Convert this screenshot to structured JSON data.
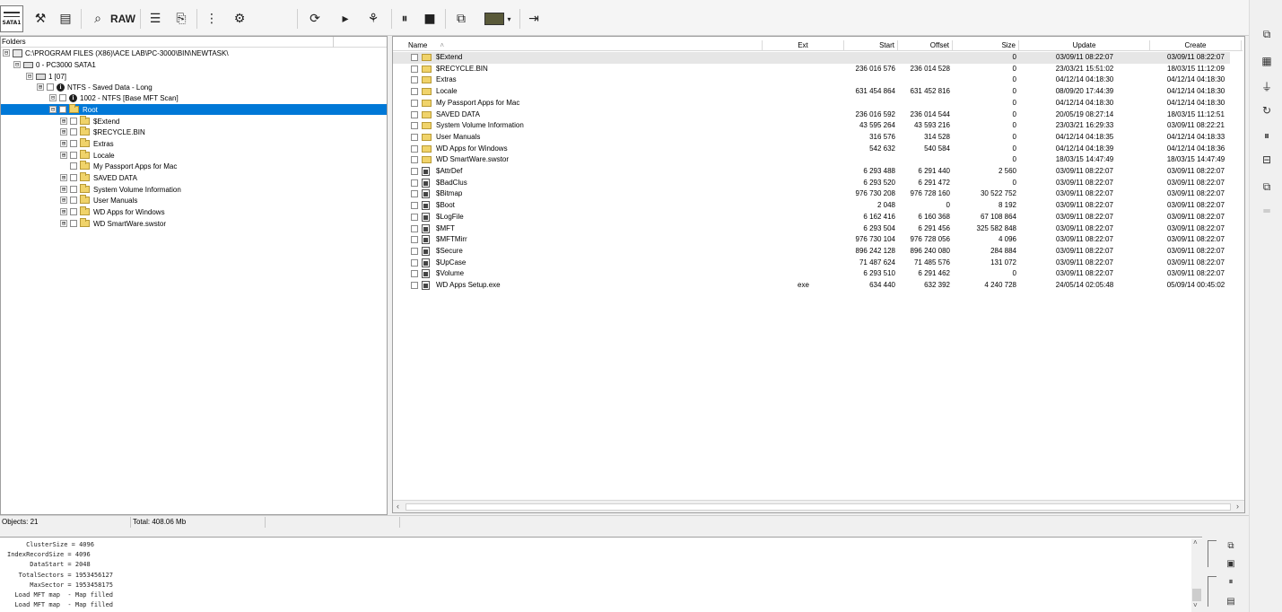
{
  "toolbar": {
    "device_label": "SATA1",
    "raw_label": "RAW"
  },
  "folders": {
    "header": "Folders",
    "tree": [
      {
        "label": "C:\\PROGRAM FILES (X86)\\ACE LAB\\PC-3000\\BIN\\NEWTASK\\",
        "exp": "⊟"
      },
      {
        "label": "0 - PC3000 SATA1",
        "exp": "⊟"
      },
      {
        "label": "1 [07]",
        "exp": "⊟"
      },
      {
        "label": "NTFS - Saved Data - Long",
        "exp": "⊞"
      },
      {
        "label": "1002 - NTFS [Base MFT Scan]",
        "exp": "⊟"
      },
      {
        "label": "Root",
        "exp": "⊟"
      },
      {
        "label": "$Extend",
        "exp": "⊞"
      },
      {
        "label": "$RECYCLE.BIN",
        "exp": "⊞"
      },
      {
        "label": "Extras",
        "exp": "⊞"
      },
      {
        "label": "Locale",
        "exp": "⊞"
      },
      {
        "label": "My Passport Apps for Mac",
        "exp": ""
      },
      {
        "label": "SAVED DATA",
        "exp": "⊞"
      },
      {
        "label": "System Volume Information",
        "exp": "⊞"
      },
      {
        "label": "User Manuals",
        "exp": "⊞"
      },
      {
        "label": "WD Apps for Windows",
        "exp": "⊞"
      },
      {
        "label": "WD SmartWare.swstor",
        "exp": "⊞"
      }
    ]
  },
  "files": {
    "columns": {
      "name": "Name",
      "ext": "Ext",
      "start": "Start",
      "offset": "Offset",
      "size": "Size",
      "update": "Update",
      "create": "Create"
    },
    "rows": [
      {
        "type": "dir",
        "name": "$Extend",
        "ext": "",
        "start": "",
        "offset": "",
        "size": "0",
        "update": "03/09/11 08:22:07",
        "create": "03/09/11 08:22:07"
      },
      {
        "type": "dir",
        "name": "$RECYCLE.BIN",
        "ext": "",
        "start": "236 016 576",
        "offset": "236 014 528",
        "size": "0",
        "update": "23/03/21 15:51:02",
        "create": "18/03/15 11:12:09"
      },
      {
        "type": "dir",
        "name": "Extras",
        "ext": "",
        "start": "",
        "offset": "",
        "size": "0",
        "update": "04/12/14 04:18:30",
        "create": "04/12/14 04:18:30"
      },
      {
        "type": "dir",
        "name": "Locale",
        "ext": "",
        "start": "631 454 864",
        "offset": "631 452 816",
        "size": "0",
        "update": "08/09/20 17:44:39",
        "create": "04/12/14 04:18:30"
      },
      {
        "type": "dir",
        "name": "My Passport Apps for Mac",
        "ext": "",
        "start": "",
        "offset": "",
        "size": "0",
        "update": "04/12/14 04:18:30",
        "create": "04/12/14 04:18:30"
      },
      {
        "type": "dir",
        "name": "SAVED DATA",
        "ext": "",
        "start": "236 016 592",
        "offset": "236 014 544",
        "size": "0",
        "update": "20/05/19 08:27:14",
        "create": "18/03/15 11:12:51"
      },
      {
        "type": "dir",
        "name": "System Volume Information",
        "ext": "",
        "start": "43 595 264",
        "offset": "43 593 216",
        "size": "0",
        "update": "23/03/21 16:29:33",
        "create": "03/09/11 08:22:21"
      },
      {
        "type": "dir",
        "name": "User Manuals",
        "ext": "",
        "start": "316 576",
        "offset": "314 528",
        "size": "0",
        "update": "04/12/14 04:18:35",
        "create": "04/12/14 04:18:33"
      },
      {
        "type": "dir",
        "name": "WD Apps for Windows",
        "ext": "",
        "start": "542 632",
        "offset": "540 584",
        "size": "0",
        "update": "04/12/14 04:18:39",
        "create": "04/12/14 04:18:36"
      },
      {
        "type": "dir",
        "name": "WD SmartWare.swstor",
        "ext": "",
        "start": "",
        "offset": "",
        "size": "0",
        "update": "18/03/15 14:47:49",
        "create": "18/03/15 14:47:49"
      },
      {
        "type": "file",
        "name": "$AttrDef",
        "ext": "",
        "start": "6 293 488",
        "offset": "6 291 440",
        "size": "2 560",
        "update": "03/09/11 08:22:07",
        "create": "03/09/11 08:22:07"
      },
      {
        "type": "file",
        "name": "$BadClus",
        "ext": "",
        "start": "6 293 520",
        "offset": "6 291 472",
        "size": "0",
        "update": "03/09/11 08:22:07",
        "create": "03/09/11 08:22:07"
      },
      {
        "type": "file",
        "name": "$Bitmap",
        "ext": "",
        "start": "976 730 208",
        "offset": "976 728 160",
        "size": "30 522 752",
        "update": "03/09/11 08:22:07",
        "create": "03/09/11 08:22:07"
      },
      {
        "type": "file",
        "name": "$Boot",
        "ext": "",
        "start": "2 048",
        "offset": "0",
        "size": "8 192",
        "update": "03/09/11 08:22:07",
        "create": "03/09/11 08:22:07"
      },
      {
        "type": "file",
        "name": "$LogFile",
        "ext": "",
        "start": "6 162 416",
        "offset": "6 160 368",
        "size": "67 108 864",
        "update": "03/09/11 08:22:07",
        "create": "03/09/11 08:22:07"
      },
      {
        "type": "file",
        "name": "$MFT",
        "ext": "",
        "start": "6 293 504",
        "offset": "6 291 456",
        "size": "325 582 848",
        "update": "03/09/11 08:22:07",
        "create": "03/09/11 08:22:07"
      },
      {
        "type": "file",
        "name": "$MFTMirr",
        "ext": "",
        "start": "976 730 104",
        "offset": "976 728 056",
        "size": "4 096",
        "update": "03/09/11 08:22:07",
        "create": "03/09/11 08:22:07"
      },
      {
        "type": "file",
        "name": "$Secure",
        "ext": "",
        "start": "896 242 128",
        "offset": "896 240 080",
        "size": "284 884",
        "update": "03/09/11 08:22:07",
        "create": "03/09/11 08:22:07"
      },
      {
        "type": "file",
        "name": "$UpCase",
        "ext": "",
        "start": "71 487 624",
        "offset": "71 485 576",
        "size": "131 072",
        "update": "03/09/11 08:22:07",
        "create": "03/09/11 08:22:07"
      },
      {
        "type": "file",
        "name": "$Volume",
        "ext": "",
        "start": "6 293 510",
        "offset": "6 291 462",
        "size": "0",
        "update": "03/09/11 08:22:07",
        "create": "03/09/11 08:22:07"
      },
      {
        "type": "file",
        "name": "WD Apps Setup.exe",
        "ext": "exe",
        "start": "634 440",
        "offset": "632 392",
        "size": "4 240 728",
        "update": "24/05/14 02:05:48",
        "create": "05/09/14 00:45:02"
      }
    ]
  },
  "status": {
    "objects": "Objects: 21",
    "total": "Total: 408.06 Mb"
  },
  "log": {
    "lines": [
      "     ClusterSize = 4096",
      "IndexRecordSize = 4096",
      "      DataStart = 2048",
      "   TotalSectors = 1953456127",
      "      MaxSector = 1953458175",
      "  Load MFT map  - Map filled",
      "  Load MFT map  - Map filled"
    ]
  }
}
